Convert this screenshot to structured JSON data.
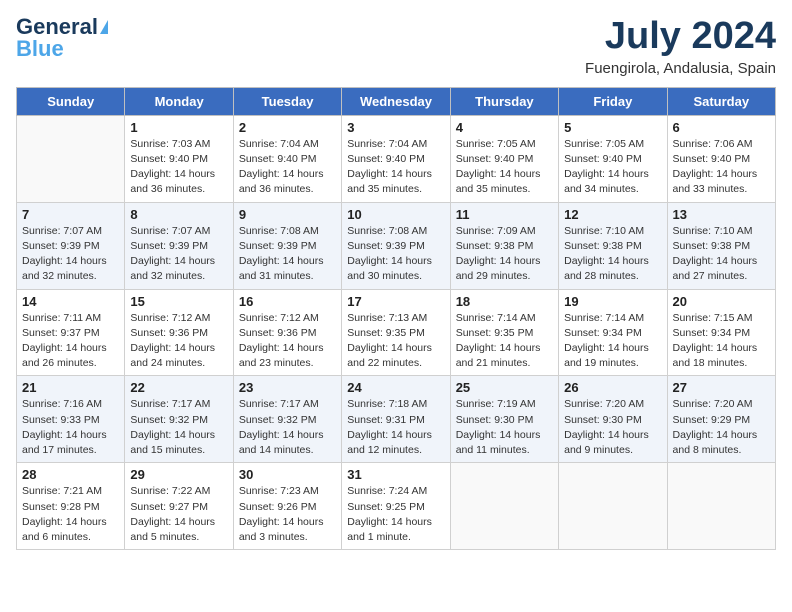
{
  "header": {
    "logo_line1": "General",
    "logo_line2": "Blue",
    "month": "July 2024",
    "location": "Fuengirola, Andalusia, Spain"
  },
  "weekdays": [
    "Sunday",
    "Monday",
    "Tuesday",
    "Wednesday",
    "Thursday",
    "Friday",
    "Saturday"
  ],
  "weeks": [
    [
      {
        "day": "",
        "info": ""
      },
      {
        "day": "1",
        "info": "Sunrise: 7:03 AM\nSunset: 9:40 PM\nDaylight: 14 hours\nand 36 minutes."
      },
      {
        "day": "2",
        "info": "Sunrise: 7:04 AM\nSunset: 9:40 PM\nDaylight: 14 hours\nand 36 minutes."
      },
      {
        "day": "3",
        "info": "Sunrise: 7:04 AM\nSunset: 9:40 PM\nDaylight: 14 hours\nand 35 minutes."
      },
      {
        "day": "4",
        "info": "Sunrise: 7:05 AM\nSunset: 9:40 PM\nDaylight: 14 hours\nand 35 minutes."
      },
      {
        "day": "5",
        "info": "Sunrise: 7:05 AM\nSunset: 9:40 PM\nDaylight: 14 hours\nand 34 minutes."
      },
      {
        "day": "6",
        "info": "Sunrise: 7:06 AM\nSunset: 9:40 PM\nDaylight: 14 hours\nand 33 minutes."
      }
    ],
    [
      {
        "day": "7",
        "info": "Sunrise: 7:07 AM\nSunset: 9:39 PM\nDaylight: 14 hours\nand 32 minutes."
      },
      {
        "day": "8",
        "info": "Sunrise: 7:07 AM\nSunset: 9:39 PM\nDaylight: 14 hours\nand 32 minutes."
      },
      {
        "day": "9",
        "info": "Sunrise: 7:08 AM\nSunset: 9:39 PM\nDaylight: 14 hours\nand 31 minutes."
      },
      {
        "day": "10",
        "info": "Sunrise: 7:08 AM\nSunset: 9:39 PM\nDaylight: 14 hours\nand 30 minutes."
      },
      {
        "day": "11",
        "info": "Sunrise: 7:09 AM\nSunset: 9:38 PM\nDaylight: 14 hours\nand 29 minutes."
      },
      {
        "day": "12",
        "info": "Sunrise: 7:10 AM\nSunset: 9:38 PM\nDaylight: 14 hours\nand 28 minutes."
      },
      {
        "day": "13",
        "info": "Sunrise: 7:10 AM\nSunset: 9:38 PM\nDaylight: 14 hours\nand 27 minutes."
      }
    ],
    [
      {
        "day": "14",
        "info": "Sunrise: 7:11 AM\nSunset: 9:37 PM\nDaylight: 14 hours\nand 26 minutes."
      },
      {
        "day": "15",
        "info": "Sunrise: 7:12 AM\nSunset: 9:36 PM\nDaylight: 14 hours\nand 24 minutes."
      },
      {
        "day": "16",
        "info": "Sunrise: 7:12 AM\nSunset: 9:36 PM\nDaylight: 14 hours\nand 23 minutes."
      },
      {
        "day": "17",
        "info": "Sunrise: 7:13 AM\nSunset: 9:35 PM\nDaylight: 14 hours\nand 22 minutes."
      },
      {
        "day": "18",
        "info": "Sunrise: 7:14 AM\nSunset: 9:35 PM\nDaylight: 14 hours\nand 21 minutes."
      },
      {
        "day": "19",
        "info": "Sunrise: 7:14 AM\nSunset: 9:34 PM\nDaylight: 14 hours\nand 19 minutes."
      },
      {
        "day": "20",
        "info": "Sunrise: 7:15 AM\nSunset: 9:34 PM\nDaylight: 14 hours\nand 18 minutes."
      }
    ],
    [
      {
        "day": "21",
        "info": "Sunrise: 7:16 AM\nSunset: 9:33 PM\nDaylight: 14 hours\nand 17 minutes."
      },
      {
        "day": "22",
        "info": "Sunrise: 7:17 AM\nSunset: 9:32 PM\nDaylight: 14 hours\nand 15 minutes."
      },
      {
        "day": "23",
        "info": "Sunrise: 7:17 AM\nSunset: 9:32 PM\nDaylight: 14 hours\nand 14 minutes."
      },
      {
        "day": "24",
        "info": "Sunrise: 7:18 AM\nSunset: 9:31 PM\nDaylight: 14 hours\nand 12 minutes."
      },
      {
        "day": "25",
        "info": "Sunrise: 7:19 AM\nSunset: 9:30 PM\nDaylight: 14 hours\nand 11 minutes."
      },
      {
        "day": "26",
        "info": "Sunrise: 7:20 AM\nSunset: 9:30 PM\nDaylight: 14 hours\nand 9 minutes."
      },
      {
        "day": "27",
        "info": "Sunrise: 7:20 AM\nSunset: 9:29 PM\nDaylight: 14 hours\nand 8 minutes."
      }
    ],
    [
      {
        "day": "28",
        "info": "Sunrise: 7:21 AM\nSunset: 9:28 PM\nDaylight: 14 hours\nand 6 minutes."
      },
      {
        "day": "29",
        "info": "Sunrise: 7:22 AM\nSunset: 9:27 PM\nDaylight: 14 hours\nand 5 minutes."
      },
      {
        "day": "30",
        "info": "Sunrise: 7:23 AM\nSunset: 9:26 PM\nDaylight: 14 hours\nand 3 minutes."
      },
      {
        "day": "31",
        "info": "Sunrise: 7:24 AM\nSunset: 9:25 PM\nDaylight: 14 hours\nand 1 minute."
      },
      {
        "day": "",
        "info": ""
      },
      {
        "day": "",
        "info": ""
      },
      {
        "day": "",
        "info": ""
      }
    ]
  ]
}
